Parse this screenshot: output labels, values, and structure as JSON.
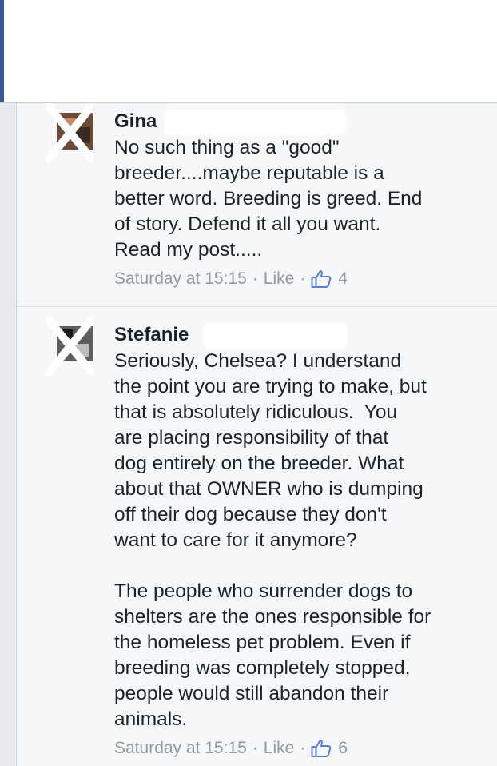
{
  "comments": [
    {
      "author_visible": "Gina",
      "text": "No such thing as a \"good\"\nbreeder....maybe reputable is a\nbetter word. Breeding is greed. End\nof story. Defend it all you want.\nRead my post.....",
      "timestamp": "Saturday at 15:15",
      "separator": "·",
      "like_label": "Like",
      "like_count": "4",
      "avatar_icon": "profile-photo-crossed-out"
    },
    {
      "author_visible": "Stefanie",
      "text": "Seriously, Chelsea? I understand\nthe point you are trying to make, but\nthat is absolutely ridiculous.  You\nare placing responsibility of that\ndog entirely on the breeder. What\nabout that OWNER who is dumping\noff their dog because they don't\nwant to care for it anymore?\n\nThe people who surrender dogs to\nshelters are the ones responsible for\nthe homeless pet problem. Even if\nbreeding was completely stopped,\npeople would still abandon their\nanimals.",
      "timestamp": "Saturday at 15:15",
      "separator": "·",
      "like_label": "Like",
      "like_count": "6",
      "avatar_icon": "profile-photo-crossed-out"
    }
  ],
  "colors": {
    "brand": "#3b5998",
    "text": "#1d2129",
    "meta": "#9197a3",
    "thumb": "#5b7bd5",
    "panel": "#f6f7f8"
  }
}
